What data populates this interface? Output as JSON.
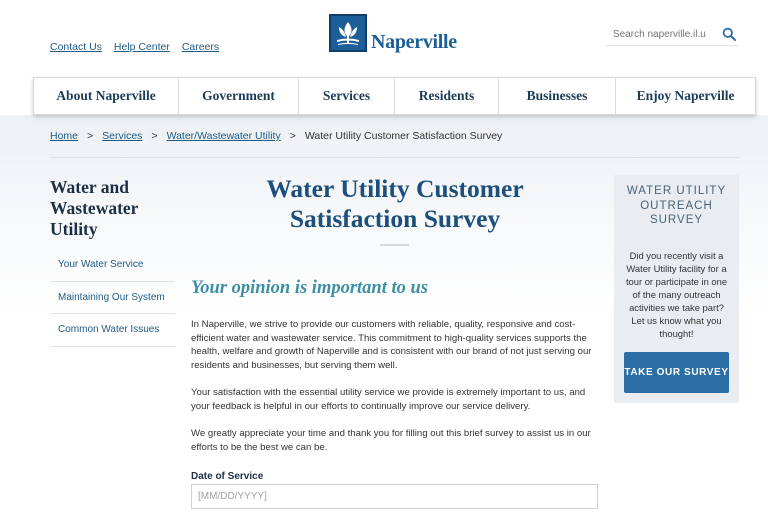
{
  "header": {
    "utility_links": [
      "Contact Us",
      "Help Center",
      "Careers"
    ],
    "logo_text": "Naperville",
    "search_placeholder": "Search naperville.il.us"
  },
  "nav": {
    "items": [
      "About Naperville",
      "Government",
      "Services",
      "Residents",
      "Businesses",
      "Enjoy Naperville"
    ]
  },
  "breadcrumb": {
    "links": [
      "Home",
      "Services",
      "Water/Wastewater Utility"
    ],
    "current": "Water Utility Customer Satisfaction Survey",
    "separator": ">"
  },
  "sidebar": {
    "title": "Water and Wastewater Utility",
    "items": [
      "Your Water Service",
      "Maintaining Our System",
      "Common Water Issues"
    ]
  },
  "main": {
    "title": "Water Utility Customer Satisfaction Survey",
    "subheading": "Your opinion is important to us",
    "paragraphs": [
      "In Naperville, we strive to provide our customers with reliable, quality, responsive and cost-efficient water and wastewater service. This commitment to high-quality services supports the health, welfare and growth of Naperville and is consistent with our brand of not just serving our residents and businesses, but serving them well.",
      "Your satisfaction with the essential utility service we provide is extremely important to us, and your feedback is helpful in our efforts to continually improve our service delivery.",
      "We greatly appreciate your time and thank you for filling out this brief survey to assist us in our efforts to be the best we can be."
    ],
    "date_label": "Date of Service",
    "date_placeholder": "[MM/DD/YYYY]"
  },
  "outreach": {
    "title": "WATER UTILITY OUTREACH SURVEY",
    "text": "Did you recently visit a Water Utility facility for a tour or participate in one of the many outreach activities we take part? Let us know what you thought!",
    "button": "TAKE OUR SURVEY"
  },
  "colors": {
    "brand_blue": "#1c5e97",
    "link_blue": "#1f5a85",
    "teal_subhead": "#3d8fa3",
    "button_blue": "#2b6ea6",
    "sidebar_box": "#e9edf1"
  },
  "icons": {
    "search": "search-icon",
    "logo": "naperville-logo-icon"
  }
}
